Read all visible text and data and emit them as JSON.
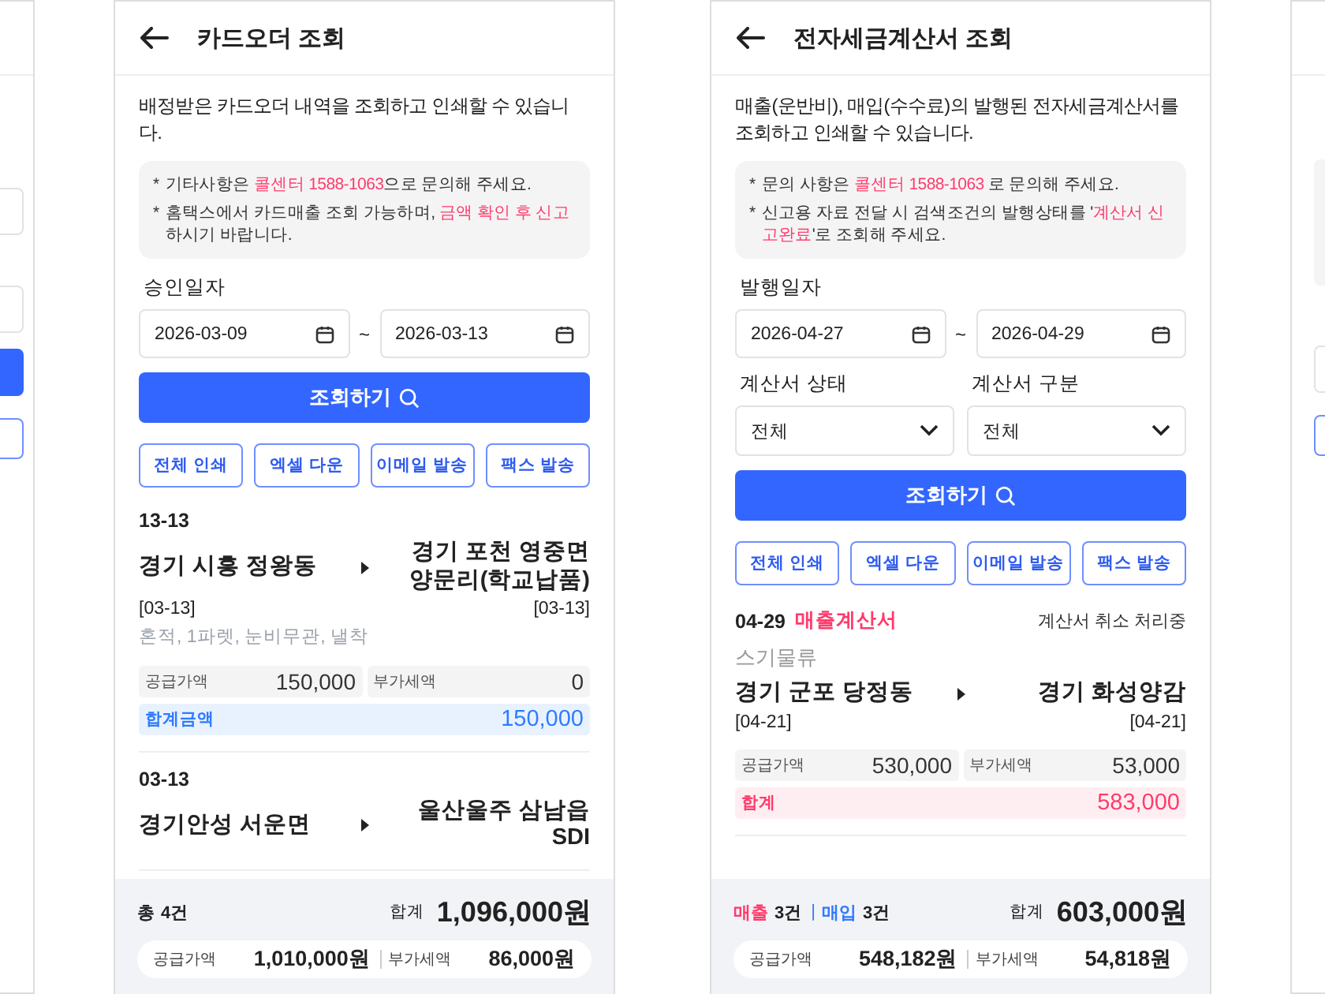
{
  "screens": [
    {
      "title": "카드오더 조회",
      "description": "배정받은 카드오더 내역을 조회하고 인쇄할 수 있습니다.",
      "notices": [
        {
          "bullet": "*",
          "parts": [
            {
              "text": "기타사항은 ",
              "highlight": false
            },
            {
              "text": "콜센터 1588-1063",
              "highlight": true
            },
            {
              "text": "으로 문의해 주세요.",
              "highlight": false
            }
          ]
        },
        {
          "bullet": "*",
          "parts": [
            {
              "text": "홈택스에서 카드매출 조회 가능하며, ",
              "highlight": false
            },
            {
              "text": "금액 확인 후 신고",
              "highlight": true
            },
            {
              "text": "하시기 바랍니다.",
              "highlight": false
            }
          ]
        }
      ],
      "date_label": "승인일자",
      "date_from": "2026-03-09",
      "date_separator": "~",
      "date_to": "2026-03-13",
      "search_button": "조회하기",
      "actions": [
        "전체 인쇄",
        "엑셀 다운",
        "이메일 발송",
        "팩스 발송"
      ],
      "records": [
        {
          "kind": "order",
          "date": "13-13",
          "from": "경기 시흥 정왕동",
          "to": "경기 포천 영중면 양문리(학교납품)",
          "from_date": "[03-13]",
          "to_date": "[03-13]",
          "memo": "혼적, 1파렛, 눈비무관, 낼착",
          "supply_label": "공급가액",
          "supply": "150,000",
          "vat_label": "부가세액",
          "vat": "0",
          "total_label": "합계금액",
          "total": "150,000"
        },
        {
          "date": "03-13",
          "from": "경기안성 서운면",
          "to": "울산울주 삼남읍 SDI"
        }
      ],
      "footer": {
        "counts": [
          {
            "label": "총",
            "value": "4건",
            "color": "#222222"
          }
        ],
        "total_label": "합계",
        "total": "1,096,000원",
        "supply_label": "공급가액",
        "supply": "1,010,000원",
        "vat_label": "부가세액",
        "vat": "86,000원"
      }
    },
    {
      "title": "전자세금계산서 조회",
      "description": "매출(운반비), 매입(수수료)의 발행된 전자세금계산서를 조회하고 인쇄할 수 있습니다.",
      "notices": [
        {
          "bullet": "*",
          "parts": [
            {
              "text": "문의 사항은 ",
              "highlight": false
            },
            {
              "text": "콜센터 1588-1063",
              "highlight": true
            },
            {
              "text": " 로 문의해 주세요.",
              "highlight": false
            }
          ]
        },
        {
          "bullet": "*",
          "parts": [
            {
              "text": "신고용 자료 전달 시 검색조건의 발행상태를 '",
              "highlight": false
            },
            {
              "text": "계산서 신고완료",
              "highlight": true
            },
            {
              "text": "'로 조회해 주세요.",
              "highlight": false
            }
          ]
        }
      ],
      "date_label": "발행일자",
      "date_from": "2026-04-27",
      "date_separator": "~",
      "date_to": "2026-04-29",
      "selects": [
        {
          "label": "계산서 상태",
          "value": "전체"
        },
        {
          "label": "계산서 구분",
          "value": "전체"
        }
      ],
      "search_button": "조회하기",
      "actions": [
        "전체 인쇄",
        "엑셀 다운",
        "이메일 발송",
        "팩스 발송"
      ],
      "records": [
        {
          "kind": "invoice",
          "date": "04-29",
          "type": "매출계산서",
          "status": "계산서 취소 처리중",
          "company": "스기물류",
          "from": "경기 군포 당정동",
          "to": "경기 화성양감",
          "from_date": "[04-21]",
          "to_date": "[04-21]",
          "supply_label": "공급가액",
          "supply": "530,000",
          "vat_label": "부가세액",
          "vat": "53,000",
          "total_label": "합계",
          "total": "583,000"
        }
      ],
      "footer": {
        "counts": [
          {
            "label": "매출",
            "value": "3건",
            "color": "#ff3b6b"
          },
          {
            "label": "매입",
            "value": "3건",
            "color": "#2f7bff"
          }
        ],
        "count_separator": "|",
        "total_label": "합계",
        "total": "603,000원",
        "supply_label": "공급가액",
        "supply": "548,182원",
        "vat_label": "부가세액",
        "vat": "54,818원"
      }
    }
  ]
}
